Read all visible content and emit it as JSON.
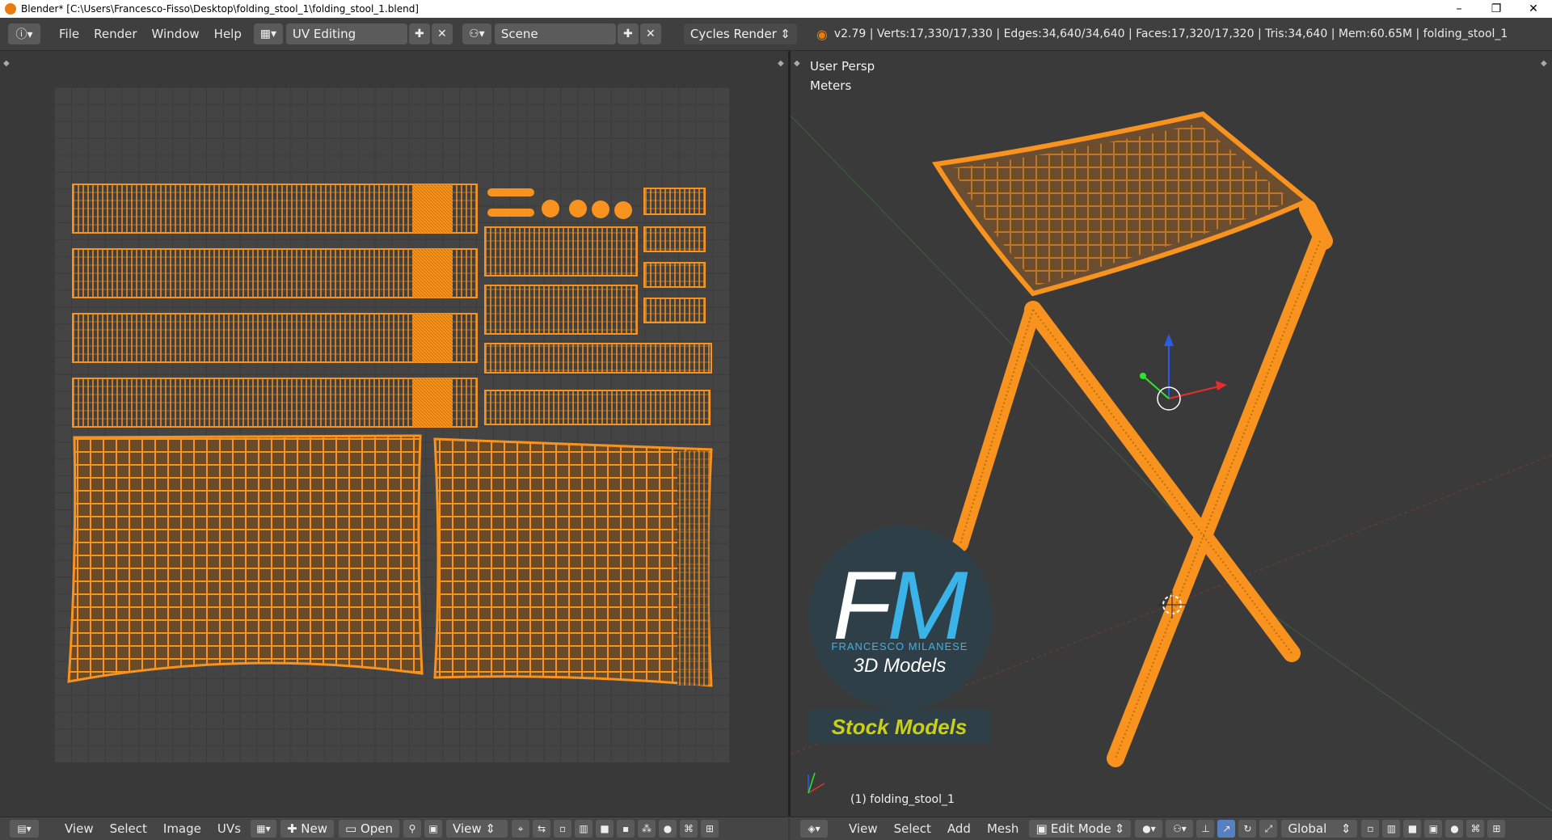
{
  "window": {
    "title": "Blender* [C:\\Users\\Francesco-Fisso\\Desktop\\folding_stool_1\\folding_stool_1.blend]",
    "minimize": "–",
    "maximize": "❐",
    "close": "✕"
  },
  "menu": {
    "items": [
      "File",
      "Render",
      "Window",
      "Help"
    ]
  },
  "layout_field": {
    "value": "UV Editing"
  },
  "scene_field": {
    "value": "Scene"
  },
  "render_engine": {
    "value": "Cycles Render"
  },
  "stats": "v2.79 | Verts:17,330/17,330 | Edges:34,640/34,640 | Faces:17,320/17,320 | Tris:34,640 | Mem:60.65M | folding_stool_1",
  "viewport": {
    "view_name": "User Persp",
    "units": "Meters",
    "object_label": "(1) folding_stool_1"
  },
  "logo": {
    "letters_f": "F",
    "letters_m": "M",
    "subtitle": "FRANCESCO MILANESE",
    "tagline": "3D Models",
    "banner": "Stock Models"
  },
  "uv_footer": {
    "items": [
      "View",
      "Select",
      "Image",
      "UVs"
    ],
    "new_label": "New",
    "open_label": "Open",
    "view_label": "View"
  },
  "vp_footer": {
    "items": [
      "View",
      "Select",
      "Add",
      "Mesh"
    ],
    "mode": "Edit Mode",
    "orientation": "Global"
  },
  "colors": {
    "mesh": "#f7931e",
    "mesh_dark": "#e07b00",
    "logo_blue": "#3ab3e8",
    "logo_bg": "#2f3f47",
    "banner_text": "#c8d01a"
  }
}
